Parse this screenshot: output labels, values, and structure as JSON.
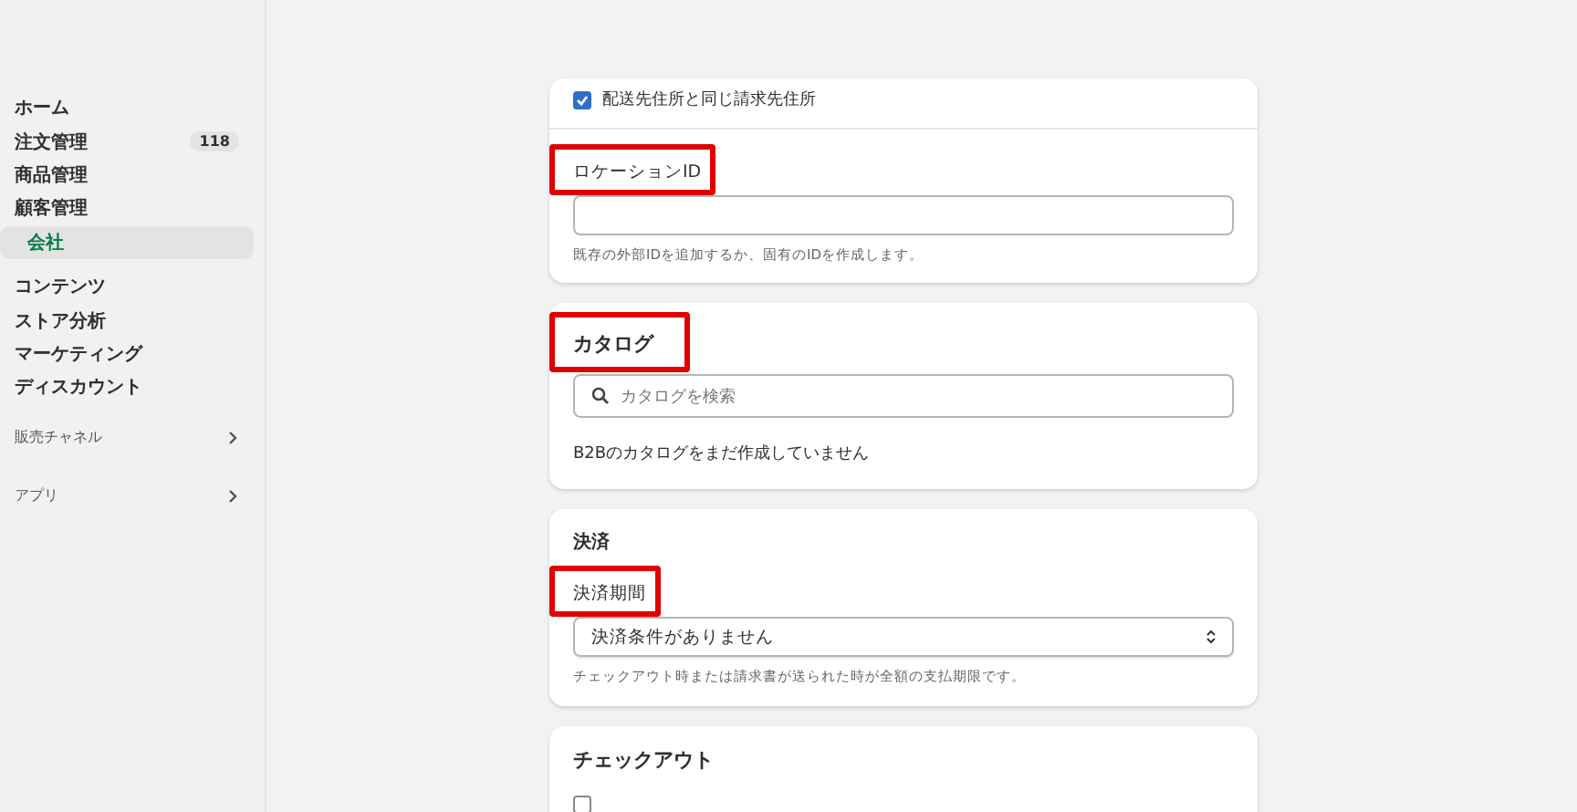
{
  "sidebar": {
    "items": [
      {
        "label": "ホーム",
        "kind": "main",
        "selected": false
      },
      {
        "label": "注文管理",
        "kind": "main",
        "selected": false,
        "badge": "118"
      },
      {
        "label": "商品管理",
        "kind": "main",
        "selected": false
      },
      {
        "label": "顧客管理",
        "kind": "main",
        "selected": false
      },
      {
        "label": "会社",
        "kind": "sub",
        "selected": true
      },
      {
        "label": "コンテンツ",
        "kind": "main",
        "selected": false
      },
      {
        "label": "ストア分析",
        "kind": "main",
        "selected": false
      },
      {
        "label": "マーケティング",
        "kind": "main",
        "selected": false
      },
      {
        "label": "ディスカウント",
        "kind": "main",
        "selected": false
      },
      {
        "label": "販売チャネル",
        "kind": "section",
        "selected": false
      },
      {
        "label": "アプリ",
        "kind": "section",
        "selected": false
      }
    ]
  },
  "cards": [
    {
      "kind": "address",
      "checkbox": {
        "label": "配送先住所と同じ請求先住所",
        "checked": true
      },
      "field": {
        "label": "ロケーションID",
        "highlighted": true,
        "help": "既存の外部IDを追加するか、固有のIDを作成します。"
      }
    },
    {
      "kind": "catalog",
      "title": "カタログ",
      "highlighted": true,
      "search": {
        "placeholder": "カタログを検索"
      },
      "note": "B2Bのカタログをまだ作成していません"
    },
    {
      "kind": "payment",
      "title": "決済",
      "field": {
        "label": "決済期間",
        "highlighted": true,
        "value": "決済条件がありません",
        "help": "チェックアウト時または請求書が送られた時が全額の支払期限です。"
      }
    },
    {
      "kind": "checkout",
      "title": "チェックアウト",
      "checkbox": {
        "checked": false
      }
    }
  ]
}
